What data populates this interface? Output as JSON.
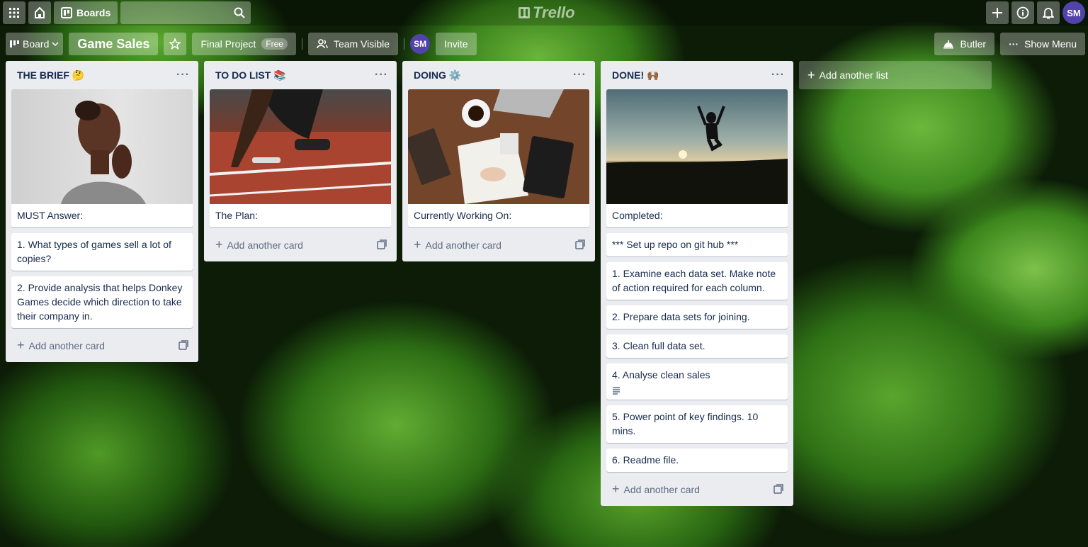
{
  "topbar": {
    "boards_label": "Boards",
    "logo_text": "Trello",
    "user_initials": "SM"
  },
  "boardbar": {
    "view_label": "Board",
    "board_title": "Game Sales",
    "team_label": "Final Project",
    "team_plan": "Free",
    "visibility_label": "Team Visible",
    "member_initials": "SM",
    "invite_label": "Invite",
    "butler_label": "Butler",
    "menu_label": "Show Menu"
  },
  "lists": [
    {
      "title": "THE BRIEF 🤔",
      "cards": [
        "MUST Answer:",
        "1. What types of games sell a lot of copies?",
        "2. Provide analysis that helps Donkey Games decide which direction to take their company in."
      ],
      "add_label": "Add another card"
    },
    {
      "title": "TO DO LIST 📚",
      "cards": [
        "The Plan:"
      ],
      "add_label": "Add another card"
    },
    {
      "title": "DOING ⚙️",
      "cards": [
        "Currently Working On:"
      ],
      "add_label": "Add another card"
    },
    {
      "title": "DONE! 🙌🏾",
      "cards": [
        "Completed:",
        "*** Set up repo on git hub ***",
        "1. Examine each data set. Make note of action required for each column.",
        "2. Prepare data sets for joining.",
        "3. Clean full data set.",
        "4. Analyse clean sales",
        "5. Power point of key findings. 10 mins.",
        "6. Readme file."
      ],
      "add_label": "Add another card"
    }
  ],
  "add_list_label": "Add another list",
  "colors": {
    "list_bg": "#ebecf0",
    "text": "#172b4d",
    "muted": "#5e6c84",
    "avatar": "#5243aa"
  }
}
